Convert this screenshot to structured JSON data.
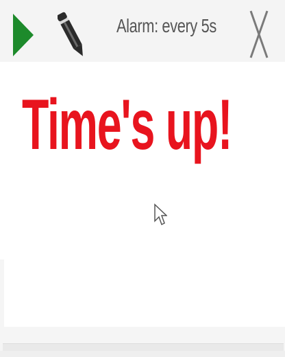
{
  "window": {
    "title": "Alarm: every 5s"
  },
  "toolbar": {
    "play_icon": "play-icon",
    "edit_icon": "pencil-icon",
    "close_icon": "close-icon"
  },
  "content": {
    "message": "Time's up!"
  },
  "colors": {
    "message": "#e8141e",
    "play": "#1d8a2b",
    "title_text": "#555555"
  }
}
